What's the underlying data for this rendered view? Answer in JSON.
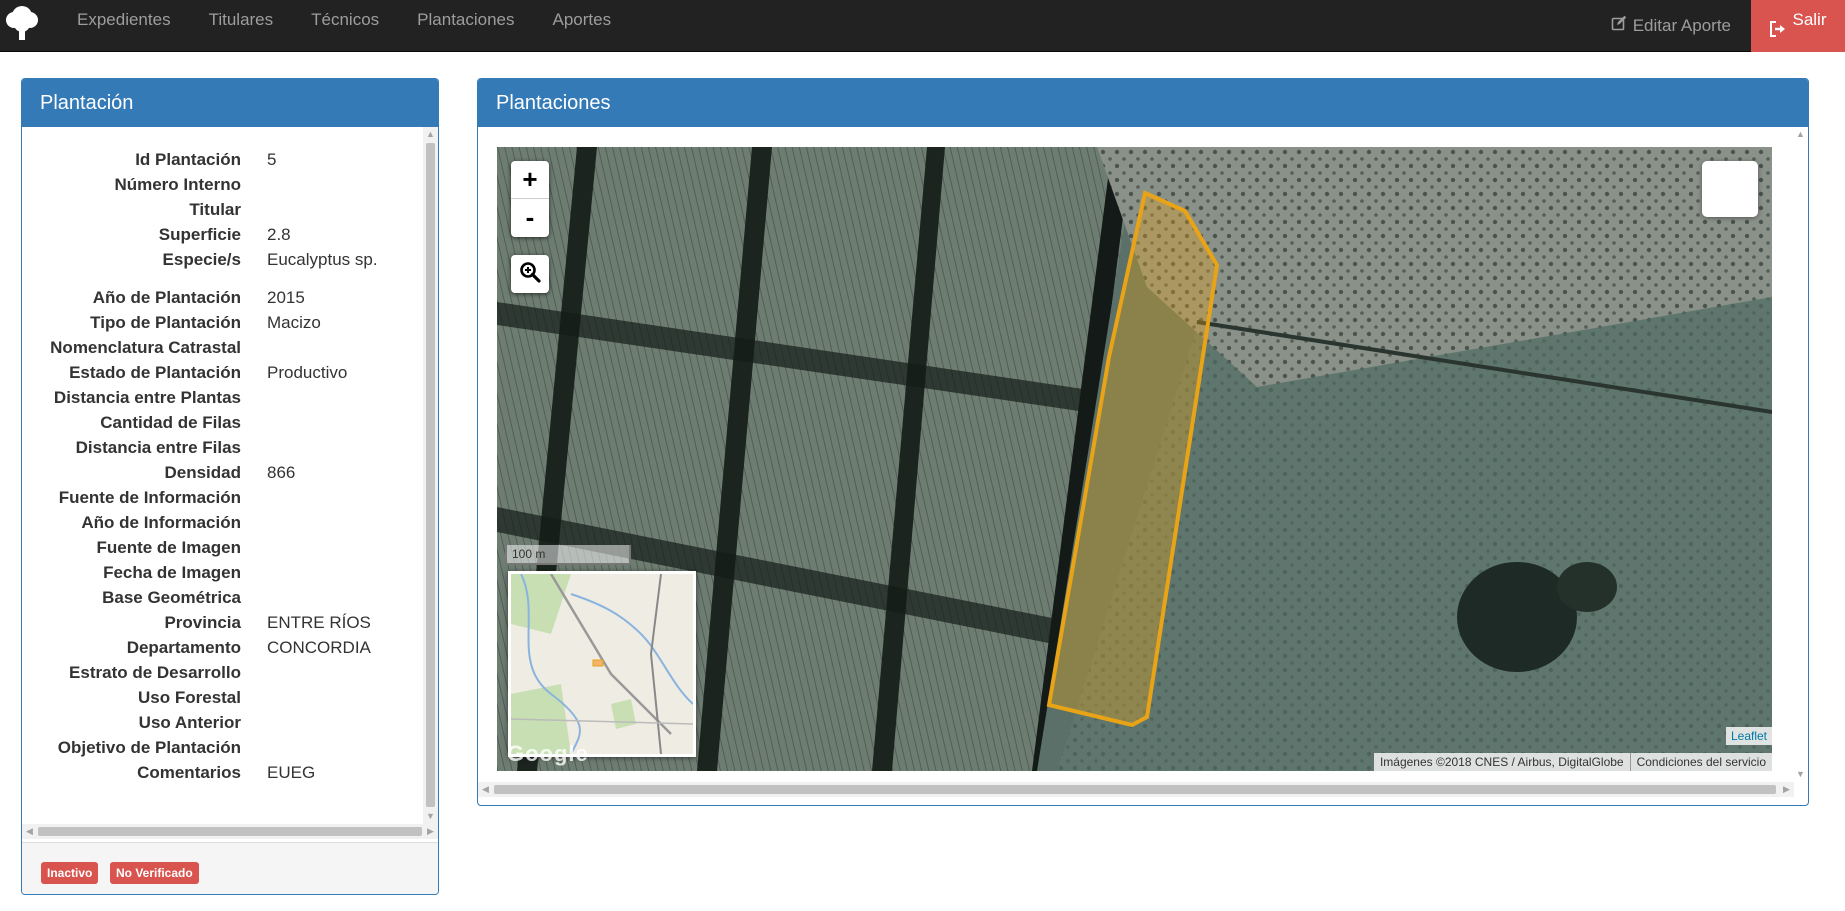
{
  "navbar": {
    "items": [
      {
        "label": "Expedientes"
      },
      {
        "label": "Titulares"
      },
      {
        "label": "Técnicos"
      },
      {
        "label": "Plantaciones"
      },
      {
        "label": "Aportes"
      }
    ],
    "edit_label": "Editar Aporte",
    "exit_label": "Salir",
    "exit_color": "#d9534f"
  },
  "details_panel": {
    "title": "Plantación",
    "fields": [
      {
        "label": "Id Plantación",
        "value": "5"
      },
      {
        "label": "Número Interno",
        "value": ""
      },
      {
        "label": "Titular",
        "value": ""
      },
      {
        "label": "Superficie",
        "value": "2.8"
      },
      {
        "label": "Especie/s",
        "value": "Eucalyptus sp."
      },
      {
        "label": "Año de Plantación",
        "value": "2015"
      },
      {
        "label": "Tipo de Plantación",
        "value": "Macizo"
      },
      {
        "label": "Nomenclatura Catrastal",
        "value": ""
      },
      {
        "label": "Estado de Plantación",
        "value": "Productivo"
      },
      {
        "label": "Distancia entre Plantas",
        "value": ""
      },
      {
        "label": "Cantidad de Filas",
        "value": ""
      },
      {
        "label": "Distancia entre Filas",
        "value": ""
      },
      {
        "label": "Densidad",
        "value": "866"
      },
      {
        "label": "Fuente de Información",
        "value": ""
      },
      {
        "label": "Año de Información",
        "value": ""
      },
      {
        "label": "Fuente de Imagen",
        "value": ""
      },
      {
        "label": "Fecha de Imagen",
        "value": ""
      },
      {
        "label": "Base Geométrica",
        "value": ""
      },
      {
        "label": "Provincia",
        "value": "ENTRE RÍOS"
      },
      {
        "label": "Departamento",
        "value": "CONCORDIA"
      },
      {
        "label": "Estrato de Desarrollo",
        "value": ""
      },
      {
        "label": "Uso Forestal",
        "value": ""
      },
      {
        "label": "Uso Anterior",
        "value": ""
      },
      {
        "label": "Objetivo de Plantación",
        "value": ""
      },
      {
        "label": "Comentarios",
        "value": "EUEG"
      }
    ],
    "badges": [
      {
        "label": "Inactivo"
      },
      {
        "label": "No Verificado"
      }
    ]
  },
  "map_panel": {
    "title": "Plantaciones",
    "zoom_in": "+",
    "zoom_out": "-",
    "scale_label": "100 m",
    "leaflet_link": "Leaflet",
    "attribution": "Imágenes ©2018 CNES / Airbus, DigitalGlobe",
    "terms": "Condiciones del servicio",
    "watermark": "Google",
    "polygon_color": "#e8a317"
  }
}
